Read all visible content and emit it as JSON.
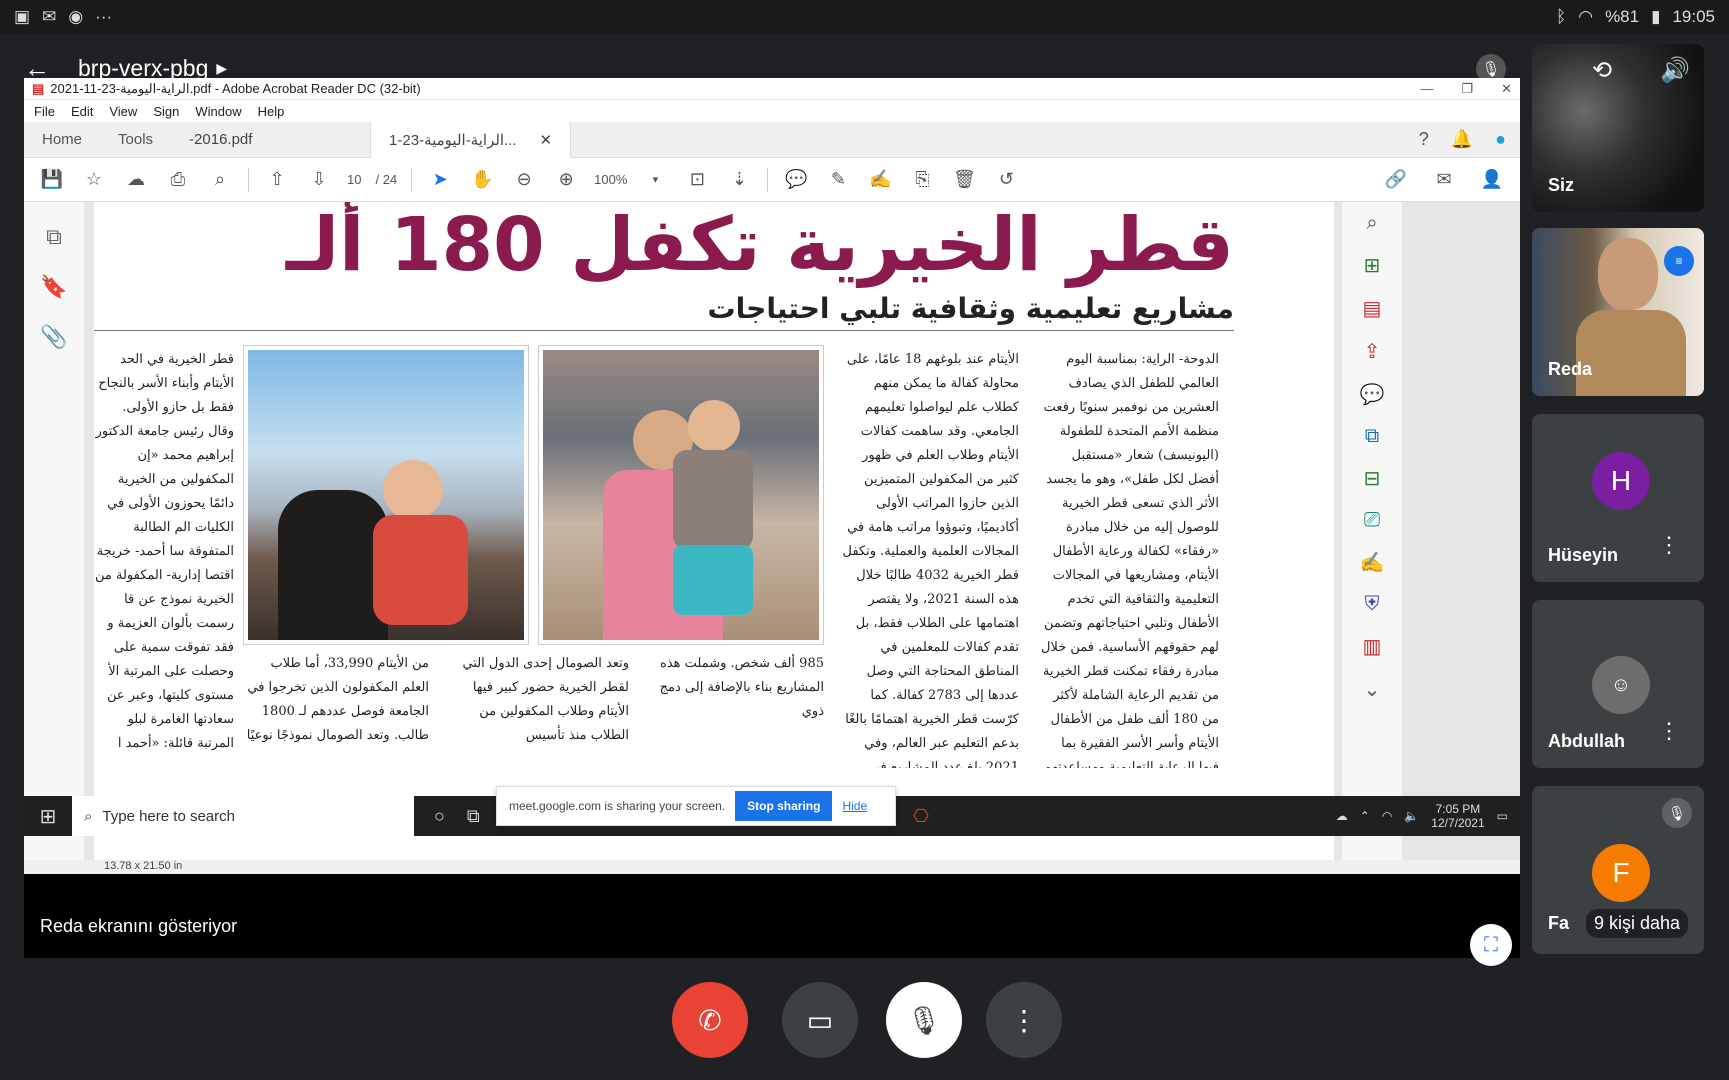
{
  "status_bar": {
    "left_icons": [
      "gallery-icon",
      "mail-icon",
      "chrome-icon",
      "more-icon"
    ],
    "battery": "%81",
    "time": "19:05"
  },
  "meeting": {
    "code": "brp-verx-pbg",
    "presenting_label": "Reda ekranını gösteriyor",
    "more_people": "9 kişi daha"
  },
  "acrobat": {
    "window_title": "2021-11-23-الراية-اليومية.pdf - Adobe Acrobat Reader DC (32-bit)",
    "menu": [
      "File",
      "Edit",
      "View",
      "Sign",
      "Window",
      "Help"
    ],
    "tabs": {
      "home": "Home",
      "tools": "Tools",
      "doc1": "-2016.pdf",
      "doc2": "الراية-اليومية-23-1..."
    },
    "page_current": "10",
    "page_total": "/ 24",
    "zoom": "100%",
    "page_size": "13.78 x 21.50 in"
  },
  "article": {
    "headline": "قطر الخيرية تكفل 180 ألـ",
    "subhead": "مشاريع تعليمية وثقافية تلبي احتياجات",
    "col_right": "الدوحة- الراية: بمناسبة اليوم العالمي للطفل الذي يصادف العشرين من نوفمبر سنويًا رفعت منظمة الأمم المتحدة للطفولة (اليونيسف) شعار «مستقبل أفضل لكل طفل»، وهو ما يجسد الأثر الذي تسعى قطر الخيرية للوصول إليه من خلال مبادرة «رفقاء» لكفالة ورعاية الأطفال الأيتام، ومشاريعها في المجالات التعليمية والثقافية التي تخدم الأطفال وتلبي احتياجاتهم وتضمن لهم حقوقهم الأساسية. فمن خلال مبادرة رفقاء تمكنت قطر الخيرية من تقديم الرعاية الشاملة لأكثر من 180 ألف طفل من الأطفال الأيتام وأسر الأسر الفقيرة بما فيها الرعاية التعليمية ومساعدتهم على",
    "col_mid": "الأيتام عند بلوغهم 18 عامًا، على محاولة كفالة ما يمكن منهم كطلاب علم ليواصلوا تعليمهم الجامعي. وقد ساهمت كفالات الأيتام وطلاب العلم في ظهور كثير من المكفولين المتميزين الذين حازوا المراتب الأولى أكاديميًا، وتبوؤوا مراتب هامة في المجالات العلمية والعملية. وتكفل قطر الخيرية 4032 طالبًا خلال هذه السنة 2021، ولا يقتصر اهتمامها على الطلاب فقط، بل تقدم كفالات للمعلمين في المناطق المحتاجة التي وصل عددها إلى 2783 كفالة. كما كرّست قطر الخيرية اهتمامًا بالغًا بدعم التعليم عبر العالم، وفي 2021 بلغ عدد المشاريع في",
    "col_left": "قطر الخيرية في الحد الأيتام وأبناء الأسر بالنجاح فقط بل حازو الأولى. وقال رئيس جامعة الدكتور إبراهيم محمد «إن المكفولين من الخيرية دائمًا يحوزون الأولى في الكليات الم الطالبة المتفوقة سا أحمد- خريجة اقتصا إدارية- المكفولة من الخيرية نموذج عن قا رسمت بألوان العزيمة و فقد تفوقت سمية على وحصلت على المرتبة الأ مستوى كليتها، وعبر عن سعادتها الغامرة لبلو المرتبة قائلة: «أحمد ا",
    "bottom_1": "985 ألف شخص. وشملت هذه المشاريع بناء بالإضافة إلى دمج ذوي",
    "bottom_2": "وتعد الصومال إحدى الدول التي لقطر الخيرية حضور كبير فيها الأيتام وطلاب المكفولين من الطلاب منذ تأسيس",
    "bottom_3": "من الأيتام 33,990، أما طلاب العلم المكفولون الذين تخرجوا في الجامعة فوصل عددهم لـ 1800 طالب. وتعد الصومال نموذجًا نوعيًا"
  },
  "share_bar": {
    "message": "meet.google.com is sharing your screen.",
    "stop": "Stop sharing",
    "hide": "Hide"
  },
  "taskbar": {
    "search_placeholder": "Type here to search",
    "time": "7:05 PM",
    "date": "12/7/2021"
  },
  "participants": {
    "self": "Siz",
    "reda": "Reda",
    "huseyin": "Hüseyin",
    "huseyin_initial": "H",
    "abdullah": "Abdullah",
    "fatih_partial": "Fa",
    "fatih_initial": "F"
  },
  "colors": {
    "headline": "#8b1a4e",
    "end_call": "#ea4335",
    "huseyin_avatar": "#7b1fa2",
    "fatih_avatar": "#f57c00",
    "stop_sharing": "#1a73e8"
  }
}
